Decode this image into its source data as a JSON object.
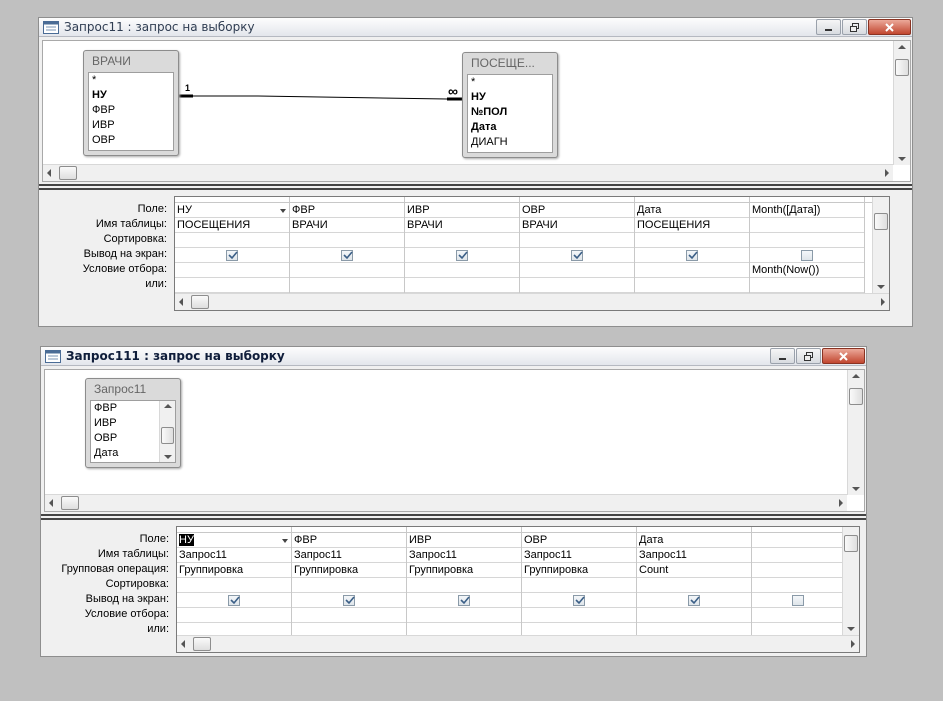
{
  "window1": {
    "title": "Запрос11 : запрос на выборку",
    "tables": [
      {
        "name": "ВРАЧИ",
        "fields": [
          {
            "name": "*",
            "pk": false
          },
          {
            "name": "НУ",
            "pk": true
          },
          {
            "name": "ФВР",
            "pk": false
          },
          {
            "name": "ИВР",
            "pk": false
          },
          {
            "name": "ОВР",
            "pk": false
          }
        ]
      },
      {
        "name": "ПОСЕЩЕ...",
        "fields": [
          {
            "name": "*",
            "pk": false
          },
          {
            "name": "НУ",
            "pk": true
          },
          {
            "name": "№ПОЛ",
            "pk": true
          },
          {
            "name": "Дата",
            "pk": true
          },
          {
            "name": "ДИАГН",
            "pk": false
          }
        ]
      }
    ],
    "relation": {
      "one": "1",
      "many": "∞"
    },
    "row_labels": [
      "Поле:",
      "Имя таблицы:",
      "Сортировка:",
      "Вывод на экран:",
      "Условие отбора:",
      "или:"
    ],
    "columns": [
      {
        "field": "НУ",
        "table": "ПОСЕЩЕНИЯ",
        "sort": "",
        "show": true,
        "criteria": "",
        "or": "",
        "dropdown": true
      },
      {
        "field": "ФВР",
        "table": "ВРАЧИ",
        "sort": "",
        "show": true,
        "criteria": "",
        "or": ""
      },
      {
        "field": "ИВР",
        "table": "ВРАЧИ",
        "sort": "",
        "show": true,
        "criteria": "",
        "or": ""
      },
      {
        "field": "ОВР",
        "table": "ВРАЧИ",
        "sort": "",
        "show": true,
        "criteria": "",
        "or": ""
      },
      {
        "field": "Дата",
        "table": "ПОСЕЩЕНИЯ",
        "sort": "",
        "show": true,
        "criteria": "",
        "or": ""
      },
      {
        "field": "Month([Дата])",
        "table": "",
        "sort": "",
        "show": false,
        "criteria": "Month(Now())",
        "or": ""
      }
    ]
  },
  "window2": {
    "title": "Запрос111 : запрос на выборку",
    "tables": [
      {
        "name": "Запрос11",
        "fields": [
          {
            "name": "ФВР",
            "pk": false
          },
          {
            "name": "ИВР",
            "pk": false
          },
          {
            "name": "ОВР",
            "pk": false
          },
          {
            "name": "Дата",
            "pk": false
          }
        ]
      }
    ],
    "row_labels": [
      "Поле:",
      "Имя таблицы:",
      "Групповая операция:",
      "Сортировка:",
      "Вывод на экран:",
      "Условие отбора:",
      "или:"
    ],
    "columns": [
      {
        "field": "НУ",
        "table": "Запрос11",
        "group": "Группировка",
        "sort": "",
        "show": true,
        "criteria": "",
        "or": "",
        "selected": true,
        "dropdown": true
      },
      {
        "field": "ФВР",
        "table": "Запрос11",
        "group": "Группировка",
        "sort": "",
        "show": true,
        "criteria": "",
        "or": ""
      },
      {
        "field": "ИВР",
        "table": "Запрос11",
        "group": "Группировка",
        "sort": "",
        "show": true,
        "criteria": "",
        "or": ""
      },
      {
        "field": "ОВР",
        "table": "Запрос11",
        "group": "Группировка",
        "sort": "",
        "show": true,
        "criteria": "",
        "or": ""
      },
      {
        "field": "Дата",
        "table": "Запрос11",
        "group": "Count",
        "sort": "",
        "show": true,
        "criteria": "",
        "or": ""
      },
      {
        "field": "",
        "table": "",
        "group": "",
        "sort": "",
        "show": false,
        "criteria": "",
        "or": ""
      }
    ]
  },
  "icons": {
    "window": "query-window-icon",
    "minimize": "minimize-icon",
    "restore": "restore-icon",
    "close": "close-icon",
    "checkbox": "check-icon"
  },
  "colors": {
    "background": "#c0c0c0",
    "window": "#f0f0f0",
    "close_button": "#c1462f",
    "active_title": "#0f1d3a",
    "checkmark": "#3b5f87"
  }
}
